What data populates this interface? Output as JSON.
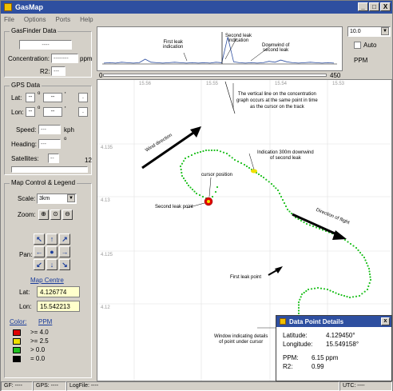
{
  "window": {
    "title": "GasMap",
    "minimize": "_",
    "maximize": "□",
    "close": "X"
  },
  "menu": [
    "File",
    "Options",
    "Ports",
    "Help"
  ],
  "gasfinder": {
    "title": "GasFinder Data",
    "status_value": "----",
    "concentration_label": "Concentration:",
    "concentration_value": "--------",
    "concentration_unit": "ppm",
    "r2_label": "R2:",
    "r2_value": "---"
  },
  "gps": {
    "title": "GPS Data",
    "lat_label": "Lat:",
    "lon_label": "Lon:",
    "dash": "--",
    "degree": "o",
    "minute": "'",
    "dot": ".",
    "speed_label": "Speed:",
    "speed_value": "---",
    "speed_unit": "kph",
    "heading_label": "Heading:",
    "heading_value": "---",
    "heading_unit": "o",
    "satellites_label": "Satellites:",
    "satellites_value": "--",
    "satellites_count": "12"
  },
  "mapcontrol": {
    "title": "Map Control & Legend",
    "scale_label": "Scale:",
    "scale_value": "3km",
    "zoom_label": "Zoom:",
    "pan_label": "Pan:",
    "map_centre_label": "Map Centre",
    "lat_label": "Lat:",
    "lat_value": "4.126774",
    "lon_label": "Lon:",
    "lon_value": "15.542213",
    "color_label": "Color:",
    "ppm_label": "PPM",
    "legend": [
      {
        "color": "#e00000",
        "text": ">= 4.0"
      },
      {
        "color": "#f0e000",
        "text": ">= 2.5"
      },
      {
        "color": "#20c020",
        "text": ">   0.0"
      },
      {
        "color": "#000000",
        "text": "=   0.0"
      }
    ]
  },
  "graph": {
    "axis_start": "0",
    "axis_end": "450",
    "annotations": {
      "first_leak": "First leak\nindication",
      "second_leak": "Second leak\nindication",
      "downwind": "Downwind of\nsecond leak"
    },
    "values": [
      0.2,
      0.3,
      0.2,
      0.4,
      0.3,
      0.2,
      0.3,
      1.1,
      0.4,
      0.3,
      0.2,
      0.3,
      0.4,
      0.3,
      0.2,
      0.3,
      0.2,
      0.3,
      0.2,
      0.4,
      0.3,
      6.2,
      0.5,
      0.3,
      0.2,
      0.3,
      0.2,
      0.3,
      0.6,
      0.4,
      0.9,
      0.5,
      0.3,
      0.2,
      0.3,
      0.4,
      0.3,
      0.2,
      0.3,
      0.2
    ]
  },
  "rightpanel": {
    "dropdown_value": "10.0",
    "auto_label": "Auto",
    "ppm_label": "PPM"
  },
  "map": {
    "coord_top": [
      "15.56",
      "15.55",
      "15.54",
      "15.53"
    ],
    "coord_left": [
      "4.135",
      "4.13",
      "4.125",
      "4.12"
    ],
    "explanation": "The vertical line on the concentration\ngraph occurs at the same point in time\nas the cursor on the track",
    "wind_direction": "Wind direction",
    "indication_300m": "Indication 300m downwind\nof second leak",
    "cursor_position": "cursor position",
    "second_leak_point": "Second leak point",
    "direction_of_flight": "Direction of flight",
    "first_leak_point": "First leak point",
    "window_indicating": "Window indicating details\nof point under cursor"
  },
  "popup": {
    "title": "Data Point Details",
    "latitude_label": "Latitude:",
    "latitude_value": "4.129450°",
    "longitude_label": "Longitude:",
    "longitude_value": "15.549158°",
    "ppm_label": "PPM:",
    "ppm_value": "6.15 ppm",
    "r2_label": "R2:",
    "r2_value": "0.99",
    "close": "x"
  },
  "status": {
    "gf": "GF: ----",
    "gps": "GPS: ----",
    "logfile": "LogFile: ----",
    "utc": "UTC: ----"
  },
  "colors": {
    "titlebar": "#2e4fa0",
    "track": "#20c020",
    "track_yellow": "#f0e000",
    "track_red": "#e00000"
  }
}
